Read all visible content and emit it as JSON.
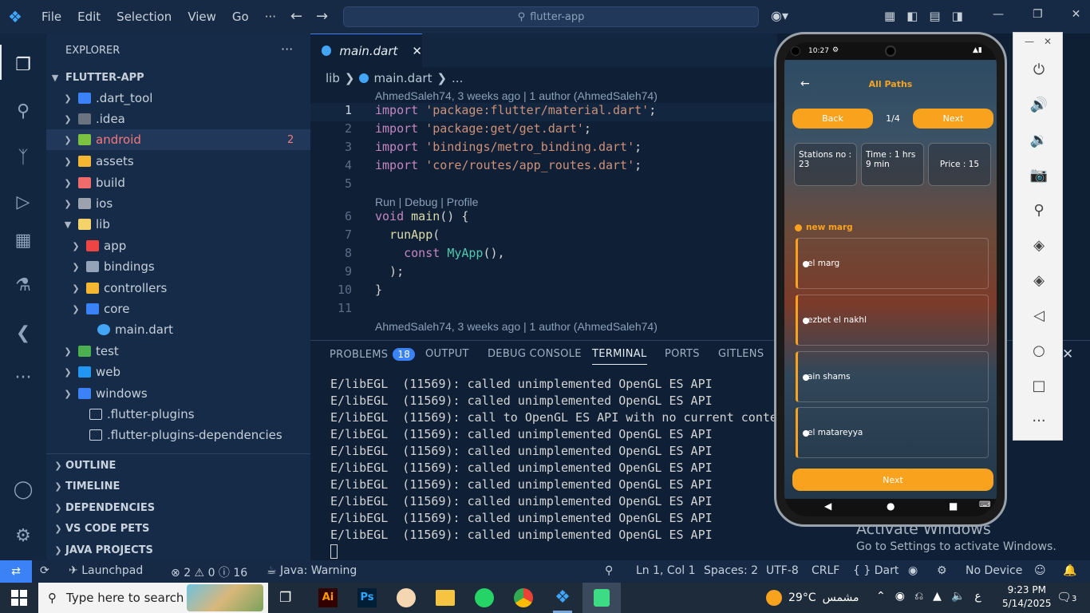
{
  "titlebar": {
    "menu": [
      "File",
      "Edit",
      "Selection",
      "View",
      "Go",
      "···"
    ],
    "search": "flutter-app"
  },
  "explorer": {
    "header": "EXPLORER",
    "root": "FLUTTER-APP",
    "items": [
      {
        "label": ".dart_tool",
        "color": "#3b82f6"
      },
      {
        "label": ".idea",
        "color": "#6b7280"
      },
      {
        "label": "android",
        "color": "#7cc242",
        "badge": "2"
      },
      {
        "label": "assets",
        "color": "#f5b731"
      },
      {
        "label": "build",
        "color": "#f06b6b"
      },
      {
        "label": "ios",
        "color": "#9ca3af"
      },
      {
        "label": "lib",
        "color": "#f5d36b"
      },
      {
        "label": "app",
        "color": "#ef4444"
      },
      {
        "label": "bindings",
        "color": "#94a3b8"
      },
      {
        "label": "controllers",
        "color": "#f5b731"
      },
      {
        "label": "core",
        "color": "#3b82f6"
      },
      {
        "label": "main.dart",
        "color": "#42a5f5"
      },
      {
        "label": "test",
        "color": "#4caf50"
      },
      {
        "label": "web",
        "color": "#2196f3"
      },
      {
        "label": "windows",
        "color": "#3b82f6"
      },
      {
        "label": ".flutter-plugins",
        "color": "#cbd5e1"
      },
      {
        "label": ".flutter-plugins-dependencies",
        "color": "#cbd5e1"
      }
    ],
    "sections": [
      "OUTLINE",
      "TIMELINE",
      "DEPENDENCIES",
      "VS CODE PETS",
      "JAVA PROJECTS"
    ]
  },
  "editor": {
    "tab": "main.dart",
    "breadcrumb": [
      "lib",
      "main.dart",
      "..."
    ],
    "blame1": "AhmedSaleh74, 3 weeks ago | 1 author (AhmedSaleh74)",
    "lens": "Run | Debug | Profile",
    "blame2": "AhmedSaleh74, 3 weeks ago | 1 author (AhmedSaleh74)",
    "line_numbers": [
      "1",
      "2",
      "3",
      "4",
      "5",
      "6",
      "7",
      "8",
      "9",
      "10",
      "11"
    ],
    "imports": [
      "'package:flutter/material.dart'",
      "'package:get/get.dart'",
      "'bindings/metro_binding.dart'",
      "'core/routes/app_routes.dart'"
    ],
    "kw_import": "import",
    "kw_void": "void",
    "fn_main": "main",
    "fn_runApp": "runApp",
    "kw_const": "const",
    "cls_MyApp": "MyApp"
  },
  "panel": {
    "tabs": [
      "PROBLEMS",
      "OUTPUT",
      "DEBUG CONSOLE",
      "TERMINAL",
      "PORTS",
      "GITLENS"
    ],
    "problems_count": "18",
    "lines": [
      "E/libEGL  (11569): called unimplemented OpenGL ES API",
      "E/libEGL  (11569): called unimplemented OpenGL ES API",
      "E/libEGL  (11569): call to OpenGL ES API with no current conte",
      "E/libEGL  (11569): called unimplemented OpenGL ES API",
      "E/libEGL  (11569): called unimplemented OpenGL ES API",
      "E/libEGL  (11569): called unimplemented OpenGL ES API",
      "E/libEGL  (11569): called unimplemented OpenGL ES API",
      "E/libEGL  (11569): called unimplemented OpenGL ES API",
      "E/libEGL  (11569): called unimplemented OpenGL ES API",
      "E/libEGL  (11569): called unimplemented OpenGL ES API"
    ]
  },
  "phone": {
    "time": "10:27",
    "title": "All Paths",
    "back": "Back",
    "page": "1/4",
    "next": "Next",
    "stations": "Stations no : 23",
    "time_card": "Time : 1 hrs 9 min",
    "price": "Price : 15",
    "current": "new marg",
    "list": [
      "el marg",
      "ezbet el nakhl",
      "ain shams",
      "el matareyya"
    ],
    "next_bottom": "Next"
  },
  "activate": {
    "title": "Activate Windows",
    "sub": "Go to Settings to activate Windows."
  },
  "status": {
    "launchpad": "Launchpad",
    "errors": "2",
    "warnings": "0",
    "info": "16",
    "java": "Java: Warning",
    "ln": "Ln 1, Col 1",
    "spaces": "Spaces: 2",
    "enc": "UTF-8",
    "eol": "CRLF",
    "lang": "Dart",
    "device": "No Device"
  },
  "taskbar": {
    "search": "Type here to search",
    "weather": "29°C",
    "weather_label": "مشمس",
    "time": "9:23 PM",
    "date": "5/14/2025",
    "notif": "3",
    "lang": "ع"
  }
}
